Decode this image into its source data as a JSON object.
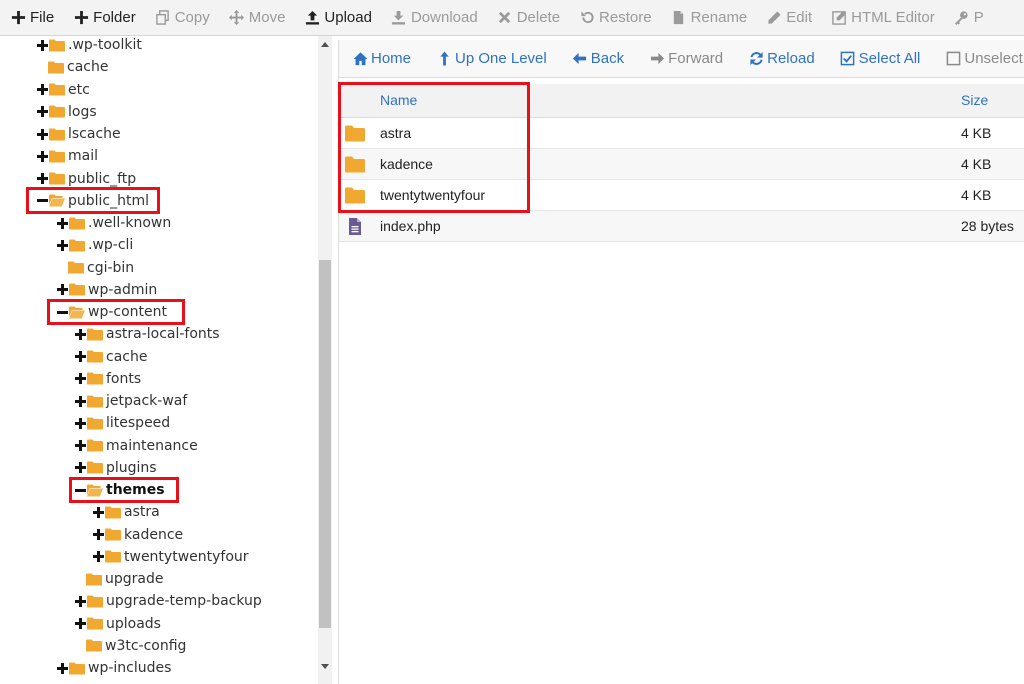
{
  "toolbar": {
    "items": [
      {
        "label": "File",
        "icon": "plus-icon"
      },
      {
        "label": "Folder",
        "icon": "plus-icon"
      },
      {
        "label": "Copy",
        "icon": "copy-icon"
      },
      {
        "label": "Move",
        "icon": "move-icon"
      },
      {
        "label": "Upload",
        "icon": "upload-icon"
      },
      {
        "label": "Download",
        "icon": "download-icon"
      },
      {
        "label": "Delete",
        "icon": "delete-icon"
      },
      {
        "label": "Restore",
        "icon": "restore-icon"
      },
      {
        "label": "Rename",
        "icon": "rename-icon"
      },
      {
        "label": "Edit",
        "icon": "pencil-icon"
      },
      {
        "label": "HTML Editor",
        "icon": "html-editor-icon"
      },
      {
        "label": "P",
        "icon": "key-icon"
      }
    ]
  },
  "tree": {
    "items": [
      {
        "label": ".wp-toolkit",
        "expander": "plus"
      },
      {
        "label": "cache",
        "expander": "none"
      },
      {
        "label": "etc",
        "expander": "plus"
      },
      {
        "label": "logs",
        "expander": "plus"
      },
      {
        "label": "lscache",
        "expander": "plus"
      },
      {
        "label": "mail",
        "expander": "plus"
      },
      {
        "label": "public_ftp",
        "expander": "plus"
      },
      {
        "label": "public_html",
        "expander": "minus"
      },
      {
        "label": ".well-known",
        "expander": "plus"
      },
      {
        "label": ".wp-cli",
        "expander": "plus"
      },
      {
        "label": "cgi-bin",
        "expander": "none"
      },
      {
        "label": "wp-admin",
        "expander": "plus"
      },
      {
        "label": "wp-content",
        "expander": "minus"
      },
      {
        "label": "astra-local-fonts",
        "expander": "plus"
      },
      {
        "label": "cache",
        "expander": "plus"
      },
      {
        "label": "fonts",
        "expander": "plus"
      },
      {
        "label": "jetpack-waf",
        "expander": "plus"
      },
      {
        "label": "litespeed",
        "expander": "plus"
      },
      {
        "label": "maintenance",
        "expander": "plus"
      },
      {
        "label": "plugins",
        "expander": "plus"
      },
      {
        "label": "themes",
        "expander": "minus"
      },
      {
        "label": "astra",
        "expander": "plus"
      },
      {
        "label": "kadence",
        "expander": "plus"
      },
      {
        "label": "twentytwentyfour",
        "expander": "plus"
      },
      {
        "label": "upgrade",
        "expander": "none"
      },
      {
        "label": "upgrade-temp-backup",
        "expander": "plus"
      },
      {
        "label": "uploads",
        "expander": "plus"
      },
      {
        "label": "w3tc-config",
        "expander": "none"
      },
      {
        "label": "wp-includes",
        "expander": "plus"
      }
    ],
    "selected": "themes"
  },
  "nav": {
    "items": [
      {
        "label": "Home",
        "icon": "home-icon"
      },
      {
        "label": "Up One Level",
        "icon": "up-arrow-icon"
      },
      {
        "label": "Back",
        "icon": "back-arrow-icon"
      },
      {
        "label": "Forward",
        "icon": "forward-arrow-icon"
      },
      {
        "label": "Reload",
        "icon": "reload-icon"
      },
      {
        "label": "Select All",
        "icon": "checked-box-icon"
      },
      {
        "label": "Unselect All",
        "icon": "empty-box-icon"
      }
    ]
  },
  "files": {
    "columns": {
      "name": "Name",
      "size": "Size"
    },
    "rows": [
      {
        "name": "astra",
        "size": "4 KB",
        "type": "folder"
      },
      {
        "name": "kadence",
        "size": "4 KB",
        "type": "folder"
      },
      {
        "name": "twentytwentyfour",
        "size": "4 KB",
        "type": "folder"
      },
      {
        "name": "index.php",
        "size": "28 bytes",
        "type": "file"
      }
    ]
  },
  "colors": {
    "highlight": "#e8101a",
    "folder": "#f0a830",
    "link": "#3072c0"
  }
}
